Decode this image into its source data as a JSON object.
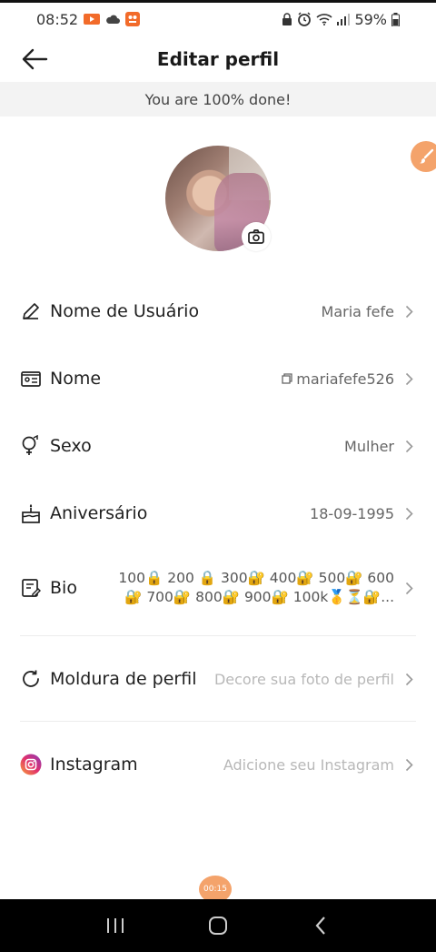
{
  "status_bar": {
    "time": "08:52",
    "battery": "59%",
    "left_icons": [
      "video-record-icon",
      "cloud-icon",
      "app-notification-icon"
    ],
    "right_icons": [
      "lock-icon",
      "alarm-icon",
      "wifi-icon",
      "signal-icon",
      "battery-icon"
    ]
  },
  "header": {
    "title": "Editar perfil",
    "back_icon": "arrow-left-icon"
  },
  "progress_banner": "You are 100% done!",
  "profile_fields": [
    {
      "label": "Nome de Usuário",
      "value": "Maria fefe",
      "icon": "pencil-icon"
    },
    {
      "label": "Nome",
      "value": "mariafefe526",
      "icon": "id-card-icon",
      "value_icon": "copy-icon"
    },
    {
      "label": "Sexo",
      "value": "Mulher",
      "icon": "gender-icon"
    },
    {
      "label": "Aniversário",
      "value": "18-09-1995",
      "icon": "cake-icon"
    },
    {
      "label": "Bio",
      "value": "100🔒 200 🔒 300🔐 400🔐 500🔐 600🔐 700🔐 800🔐 900🔐 100k🥇⏳🔐...",
      "icon": "note-edit-icon"
    }
  ],
  "extra_fields": [
    {
      "label": "Moldura de perfil",
      "value": "Decore sua foto de perfil",
      "icon": "frame-refresh-icon"
    },
    {
      "label": "Instagram",
      "value": "Adicione seu Instagram",
      "icon": "instagram-icon"
    }
  ],
  "timer": "00:15",
  "colors": {
    "accent": "#f4a36b",
    "banner_bg": "#f3f3f3",
    "placeholder": "#b8b8b8"
  }
}
